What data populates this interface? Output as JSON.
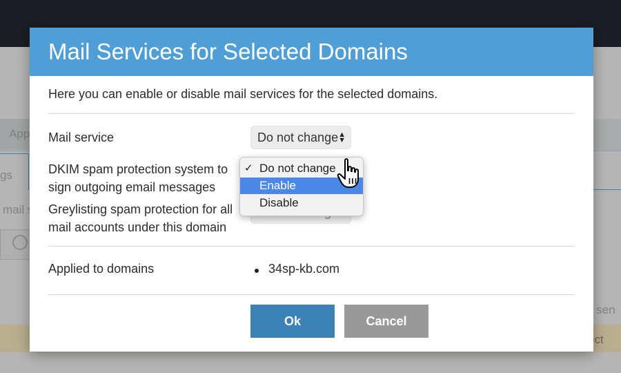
{
  "background": {
    "tab_fragment": "App",
    "tab_active_fragment": "gs",
    "text_fragment": "mail s",
    "right_text_fragment": "il sen",
    "yellow_text_fragment": "ect"
  },
  "modal": {
    "title": "Mail Services for Selected Domains",
    "intro": "Here you can enable or disable mail services for the selected domains.",
    "fields": [
      {
        "label": "Mail service",
        "value": "Do not change"
      },
      {
        "label": "DKIM spam protection system to sign outgoing email messages",
        "value": "Do not change"
      },
      {
        "label": "Greylisting spam protection for all mail accounts under this domain",
        "value": "Do not change"
      }
    ],
    "dropdown": {
      "options": [
        "Do not change",
        "Enable",
        "Disable"
      ],
      "checked": "Do not change",
      "highlighted": "Enable",
      "check_mark": "✓"
    },
    "applied_label": "Applied to domains",
    "domains": [
      "34sp-kb.com"
    ],
    "ok_label": "Ok",
    "cancel_label": "Cancel"
  },
  "colors": {
    "header": "#4f9ed6",
    "ok_button": "#3b81b6",
    "cancel_button": "#999999",
    "dropdown_highlight": "#4a87e6"
  },
  "icons": {
    "select_arrows": "updown-arrows-icon",
    "cursor": "hand-pointer-icon",
    "globe": "globe-icon"
  }
}
